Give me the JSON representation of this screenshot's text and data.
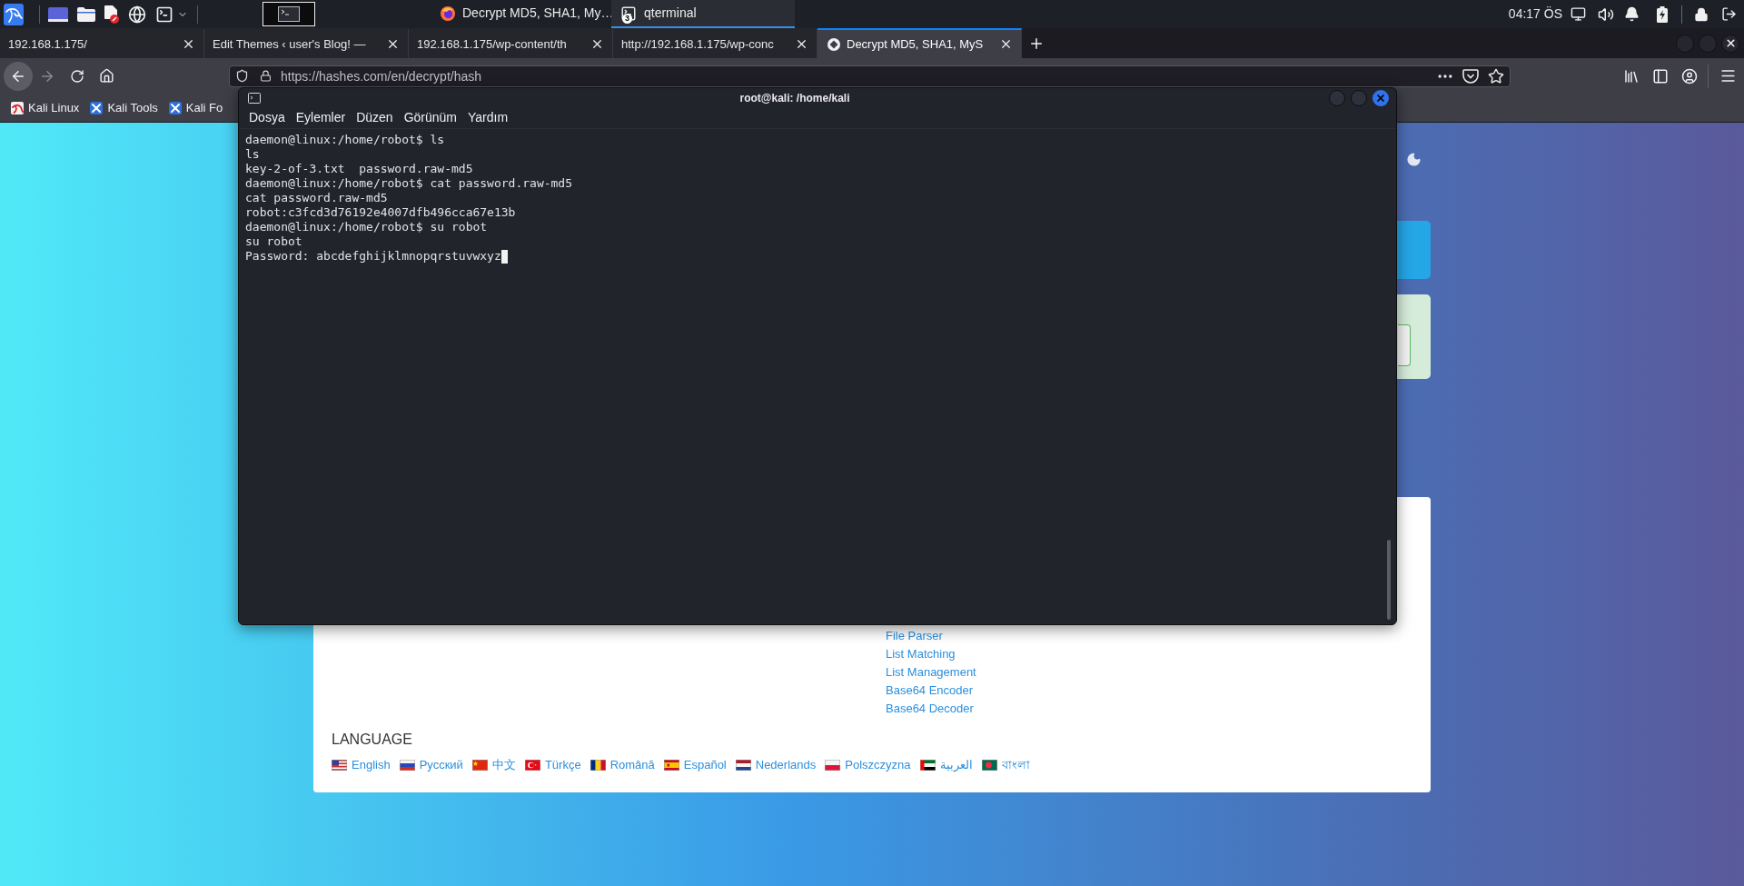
{
  "top_panel": {
    "tasks": [
      {
        "title": "Decrypt MD5, SHA1, My…",
        "kind": "browser",
        "selected": false
      },
      {
        "title": "qterminal",
        "kind": "terminal",
        "selected": true,
        "badge": "3"
      }
    ],
    "clock": "04:17 ÖS"
  },
  "browser": {
    "tabs": [
      {
        "title": "192.168.1.175/",
        "selected": false,
        "favicon": false
      },
      {
        "title": "Edit Themes ‹ user's Blog! —",
        "selected": false,
        "favicon": false
      },
      {
        "title": "192.168.1.175/wp-content/th",
        "selected": false,
        "favicon": false
      },
      {
        "title": "http://192.168.1.175/wp-conc",
        "selected": false,
        "favicon": false
      },
      {
        "title": "Decrypt MD5, SHA1, MyS",
        "selected": true,
        "favicon": true
      }
    ],
    "nav_buttons": [
      {
        "kind": "back",
        "disabled": false
      },
      {
        "kind": "forward",
        "disabled": true
      },
      {
        "kind": "reload",
        "disabled": false
      },
      {
        "kind": "home",
        "disabled": false
      }
    ],
    "url": "https://hashes.com/en/decrypt/hash",
    "bookmarks": [
      {
        "label": "Kali Linux",
        "kind": "dragon"
      },
      {
        "label": "Kali Tools",
        "kind": "tools"
      },
      {
        "label": "Kali Fo",
        "kind": "tools"
      }
    ]
  },
  "page": {
    "tool_links": [
      "File Parser",
      "List Matching",
      "List Management",
      "Base64 Encoder",
      "Base64 Decoder"
    ],
    "language_heading": "LANGUAGE",
    "languages": [
      {
        "label": "English",
        "kind": "us"
      },
      {
        "label": "Русский",
        "kind": "ru"
      },
      {
        "label": "中文",
        "kind": "cn"
      },
      {
        "label": "Türkçe",
        "kind": "tr"
      },
      {
        "label": "Română",
        "kind": "ro"
      },
      {
        "label": "Español",
        "kind": "es"
      },
      {
        "label": "Nederlands",
        "kind": "nl"
      },
      {
        "label": "Polszczyzna",
        "kind": "pl"
      },
      {
        "label": "العربية",
        "kind": "ae"
      },
      {
        "label": "বাংলা",
        "kind": "bd"
      }
    ]
  },
  "terminal": {
    "title": "root@kali: /home/kali",
    "menu": [
      "Dosya",
      "Eylemler",
      "Düzen",
      "Görünüm",
      "Yardım"
    ],
    "lines": [
      "daemon@linux:/home/robot$ ls",
      "ls",
      "key-2-of-3.txt  password.raw-md5",
      "daemon@linux:/home/robot$ cat password.raw-md5",
      "cat password.raw-md5",
      "robot:c3fcd3d76192e4007dfb496cca67e13b",
      "daemon@linux:/home/robot$ su robot",
      "su robot",
      "Password: abcdefghijklmnopqrstuvwxyz"
    ],
    "cursor": true
  }
}
